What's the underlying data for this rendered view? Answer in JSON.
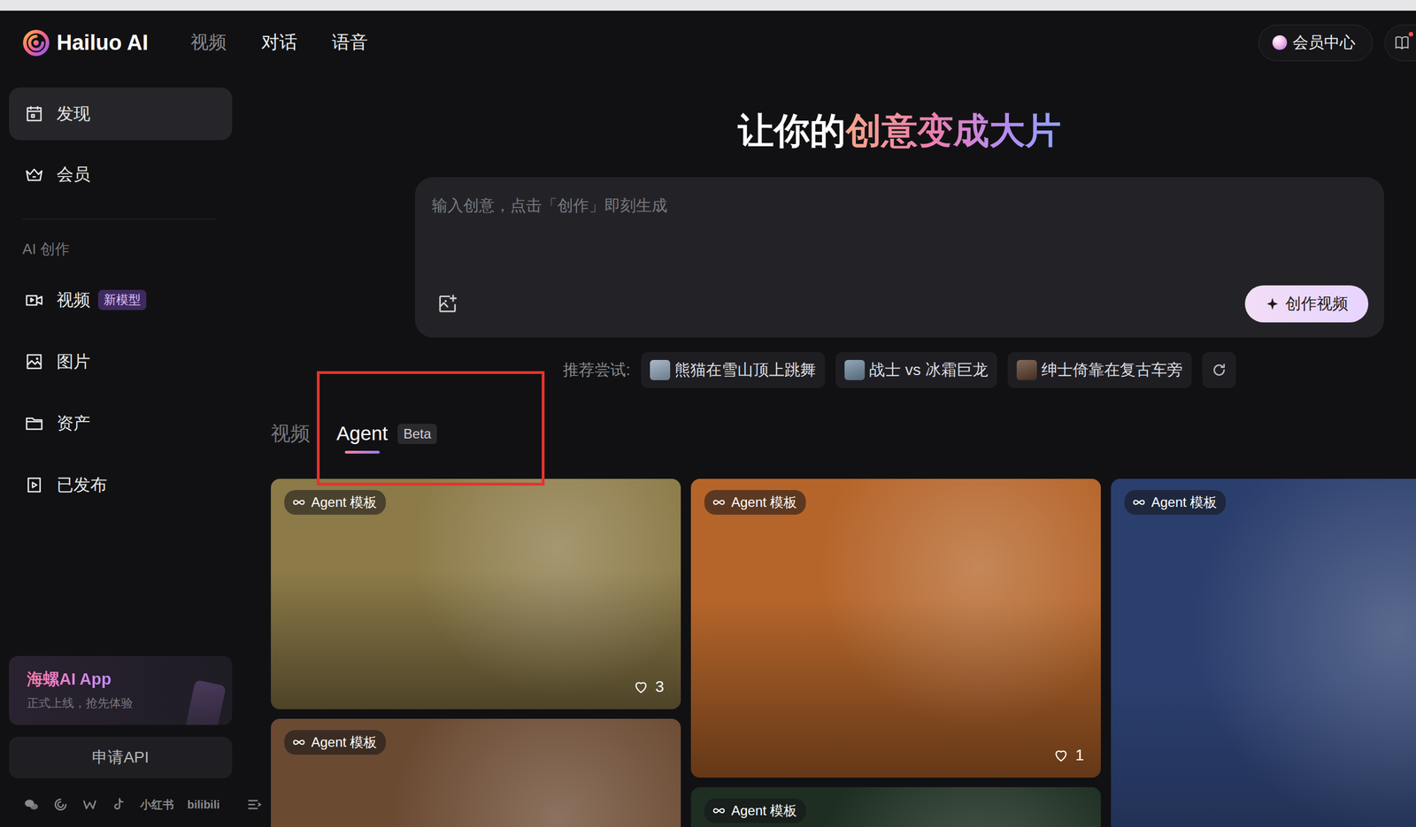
{
  "header": {
    "logo": "Hailuo AI",
    "nav": [
      {
        "label": "视频",
        "dimmed": true
      },
      {
        "label": "对话",
        "dimmed": false
      },
      {
        "label": "语音",
        "dimmed": false
      }
    ],
    "member_button": "会员中心"
  },
  "sidebar": {
    "main_items": [
      {
        "label": "发现",
        "selected": true
      },
      {
        "label": "会员",
        "selected": false
      }
    ],
    "section_title": "AI 创作",
    "section_items": [
      {
        "label": "视频",
        "badge": "新模型",
        "selected": false
      },
      {
        "label": "图片",
        "selected": false
      },
      {
        "label": "资产",
        "selected": false
      },
      {
        "label": "已发布",
        "selected": false
      }
    ],
    "promo": {
      "title": "海螺AI App",
      "subtitle": "正式上线，抢先体验"
    },
    "api_button": "申请API",
    "social_labels": [
      "小红书",
      "bilibili"
    ]
  },
  "hero": {
    "title": "让你的",
    "title_highlight": "创意变成大片"
  },
  "prompt": {
    "placeholder": "输入创意，点击「创作」即刻生成",
    "submit": "创作视频"
  },
  "suggestions": {
    "label": "推荐尝试:",
    "items": [
      {
        "label": "熊猫在雪山顶上跳舞",
        "color": "#8fa3b8"
      },
      {
        "label": "战士 vs 冰霜巨龙",
        "color": "#6f8aa0"
      },
      {
        "label": "绅士倚靠在复古车旁",
        "color": "#5a3a28"
      }
    ]
  },
  "feed_tabs": {
    "highlighted": true,
    "items": [
      {
        "label": "视频",
        "selected": false
      },
      {
        "label": "Agent",
        "badge": "Beta",
        "selected": true
      }
    ]
  },
  "cards": [
    [
      {
        "tag": "Agent 模板",
        "likes": "3",
        "color": "#8c7a48"
      },
      {
        "tag": "Agent 模板",
        "color": "#6b4a32"
      }
    ],
    [
      {
        "tag": "Agent 模板",
        "likes": "1",
        "color": "#b5652a"
      },
      {
        "tag": "Agent 模板",
        "color": "#1e2e22"
      }
    ],
    [
      {
        "tag": "Agent 模板",
        "color": "#2b3f6e"
      }
    ]
  ]
}
